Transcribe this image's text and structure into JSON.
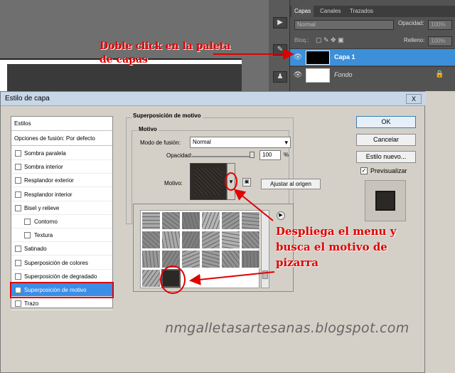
{
  "layers_panel": {
    "tabs": [
      "Capas",
      "Canales",
      "Trazados"
    ],
    "blend_mode": "Normal",
    "opacity_label": "Opacidad:",
    "opacity_value": "100%",
    "lock_label": "Bloq.:",
    "fill_label": "Relleno:",
    "fill_value": "100%",
    "layers": [
      {
        "name": "Capa 1",
        "selected": true
      },
      {
        "name": "Fondo",
        "selected": false
      }
    ]
  },
  "annotations": {
    "top": "Doble click en la paleta de capas",
    "bottom": "Despliega el menu y busca el motivo de pizarra",
    "color": "#e00000"
  },
  "dialog": {
    "title": "Estilo de capa",
    "close": "X",
    "styles_header": "Estilos",
    "blend_options": "Opciones de fusión: Por defecto",
    "styles": [
      {
        "label": "Sombra paralela",
        "checked": false,
        "sub": false
      },
      {
        "label": "Sombra interior",
        "checked": false,
        "sub": false
      },
      {
        "label": "Resplandor exterior",
        "checked": false,
        "sub": false
      },
      {
        "label": "Resplandor interior",
        "checked": false,
        "sub": false
      },
      {
        "label": "Bisel y relieve",
        "checked": false,
        "sub": false
      },
      {
        "label": "Contorno",
        "checked": false,
        "sub": true
      },
      {
        "label": "Textura",
        "checked": false,
        "sub": true
      },
      {
        "label": "Satinado",
        "checked": false,
        "sub": false
      },
      {
        "label": "Superposición de colores",
        "checked": false,
        "sub": false
      },
      {
        "label": "Superposición de degradado",
        "checked": false,
        "sub": false
      },
      {
        "label": "Superposición de motivo",
        "checked": true,
        "sub": false,
        "selected": true
      },
      {
        "label": "Trazo",
        "checked": false,
        "sub": false
      }
    ],
    "group_title": "Superposición de motivo",
    "subgroup_title": "Motivo",
    "blend_label": "Modo de fusión:",
    "blend_value": "Normal",
    "opacity_label": "Opacidad:",
    "opacity_value": "100",
    "opacity_unit": "%",
    "opacity_level": 1.0,
    "motif_label": "Motivo:",
    "snap_button": "Ajustar al origen",
    "ok": "OK",
    "cancel": "Cancelar",
    "new_style": "Estilo nuevo...",
    "preview_label": "Previsualizar",
    "preview_checked": true
  },
  "watermark": "nmgalletasartesanas.blogspot.com"
}
